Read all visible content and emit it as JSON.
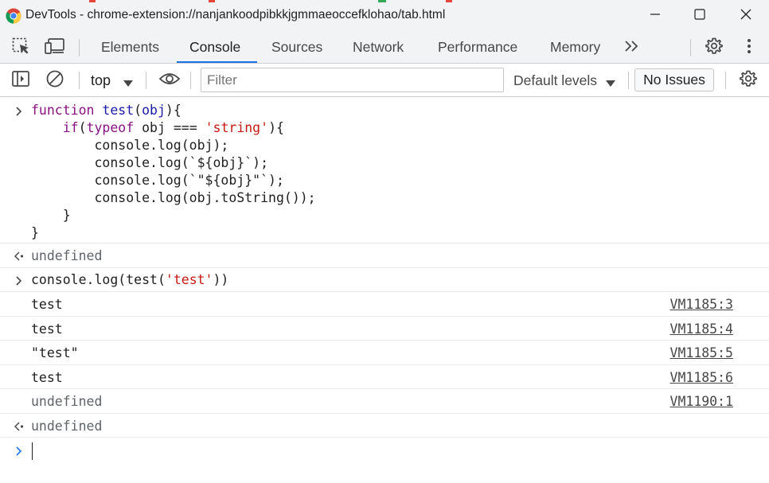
{
  "window": {
    "title": "DevTools - chrome-extension://nanjankoodpibkkjgmmaeoccefklohao/tab.html",
    "controls": {
      "minimize": "minimize-icon",
      "maximize": "maximize-icon",
      "close": "close-icon"
    }
  },
  "tabs": {
    "items": [
      {
        "label": "Elements"
      },
      {
        "label": "Console"
      },
      {
        "label": "Sources"
      },
      {
        "label": "Network"
      },
      {
        "label": "Performance"
      },
      {
        "label": "Memory"
      }
    ],
    "active": "Console",
    "more_icon": "double-chevron-right-icon"
  },
  "toolbar": {
    "context": "top",
    "filter_placeholder": "Filter",
    "filter_value": "",
    "levels": "Default levels",
    "issues": "No Issues"
  },
  "console": {
    "input1": {
      "lines": [
        [
          [
            "kw",
            "function"
          ],
          [
            "pl",
            " "
          ],
          [
            "fn",
            "test"
          ],
          [
            "pl",
            "("
          ],
          [
            "fn",
            "obj"
          ],
          [
            "pl",
            "){"
          ]
        ],
        [
          [
            "pl",
            "    "
          ],
          [
            "kw",
            "if"
          ],
          [
            "pl",
            "("
          ],
          [
            "kw",
            "typeof"
          ],
          [
            "pl",
            " obj === "
          ],
          [
            "str",
            "'string'"
          ],
          [
            "pl",
            "){"
          ]
        ],
        [
          [
            "pl",
            "        console.log(obj);"
          ]
        ],
        [
          [
            "pl",
            "        console.log(`${obj}`);"
          ]
        ],
        [
          [
            "pl",
            "        console.log(`\"${obj}\"`);"
          ]
        ],
        [
          [
            "pl",
            "        console.log(obj.toString());"
          ]
        ],
        [
          [
            "pl",
            "    }"
          ]
        ],
        [
          [
            "pl",
            "}"
          ]
        ]
      ]
    },
    "result1": "undefined",
    "input2": {
      "lines": [
        [
          [
            "pl",
            "console.log(test("
          ],
          [
            "str",
            "'test'"
          ],
          [
            "pl",
            "))"
          ]
        ]
      ]
    },
    "logs": [
      {
        "text": "test",
        "source": "VM1185:3",
        "muted": false
      },
      {
        "text": "test",
        "source": "VM1185:4",
        "muted": false
      },
      {
        "text": "\"test\"",
        "source": "VM1185:5",
        "muted": false
      },
      {
        "text": "test",
        "source": "VM1185:6",
        "muted": false
      },
      {
        "text": "undefined",
        "source": "VM1190:1",
        "muted": true
      }
    ],
    "result2": "undefined",
    "prompt_value": ""
  },
  "colors": {
    "accent": "#1a73e8",
    "keyword": "#881280",
    "function": "#1a1aa6",
    "string": "#c41a16",
    "muted": "#5f6368"
  }
}
